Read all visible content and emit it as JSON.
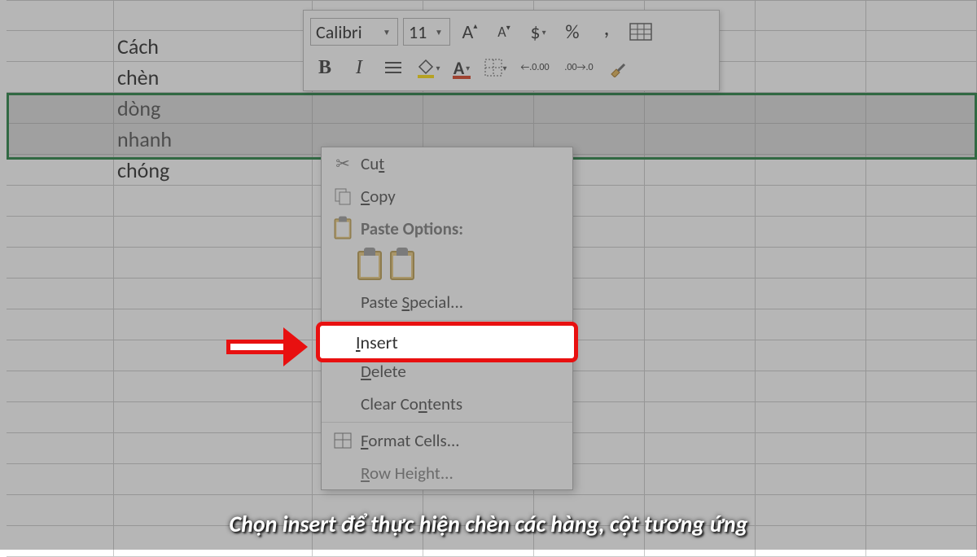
{
  "cells": {
    "b2": "Cách",
    "b3": "chèn",
    "b4": "dòng",
    "b5": "nhanh",
    "b6": "chóng"
  },
  "mini_toolbar": {
    "font_name": "Calibri",
    "font_size": "11",
    "increase_a": "A",
    "decrease_a": "A",
    "currency": "$",
    "percent": "%",
    "comma": ",",
    "bold": "B",
    "italic": "I",
    "dec_inc": ".00",
    "dec_dec": ".00"
  },
  "context_menu": {
    "cut": "Cut",
    "copy": "Copy",
    "paste_options": "Paste Options:",
    "paste_special": "Paste Special...",
    "insert": "Insert",
    "delete": "Delete",
    "clear_contents": "Clear Contents",
    "format_cells": "Format Cells...",
    "row_height": "Row Height..."
  },
  "caption": "Chọn insert để thực hiện chèn các hàng, cột tương ứng"
}
